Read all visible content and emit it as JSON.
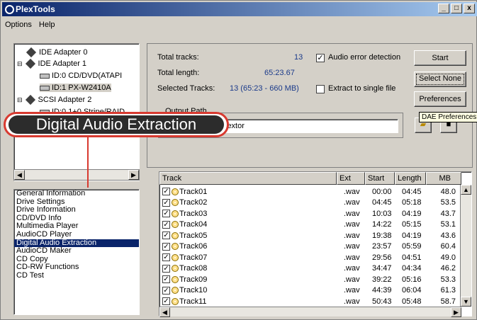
{
  "window": {
    "title": "PlexTools",
    "controls": [
      "_",
      "□",
      "x"
    ]
  },
  "menu": [
    "Options",
    "Help"
  ],
  "tree": [
    {
      "label": "IDE Adapter 0",
      "type": "adapter"
    },
    {
      "label": "IDE Adapter 1",
      "type": "adapter"
    },
    {
      "label": "ID:0  CD/DVD(ATAPI",
      "type": "drive"
    },
    {
      "label": "ID:1  PX-W2410A",
      "type": "drive",
      "selected": true
    },
    {
      "label": "SCSI Adapter 2",
      "type": "adapter"
    },
    {
      "label": "ID:0  1+0 Stripe/RAID",
      "type": "drive"
    }
  ],
  "nav_list": [
    "General Information",
    "Drive Settings",
    "Drive Information",
    "CD/DVD Info",
    "Multimedia Player",
    "AudioCD Player",
    "Digital Audio Extraction",
    "AudioCD Maker",
    "CD Copy",
    "CD-RW Functions",
    "CD Test"
  ],
  "active_nav": "Digital Audio Extraction",
  "summary": {
    "total_tracks_label": "Total tracks:",
    "total_tracks": "13",
    "total_length_label": "Total length:",
    "total_length": "65:23.67",
    "selected_label": "Selected Tracks:",
    "selected": "13  (65:23 - 660 MB)"
  },
  "options": {
    "audio_error_detection": {
      "label": "Audio error detection",
      "checked": true
    },
    "extract_single_file": {
      "label": "Extract to single file",
      "checked": false
    }
  },
  "buttons": {
    "start": "Start",
    "select_none": "Select None",
    "preferences": "Preferences"
  },
  "output_path": {
    "label": "Output Path",
    "value": "lextor"
  },
  "tooltip": "DAE Preferences",
  "callout": "Digital Audio Extraction",
  "track_columns": [
    "Track",
    "Ext",
    "Start",
    "Length",
    "MB"
  ],
  "tracks": [
    {
      "name": "Track01",
      "ext": ".wav",
      "start": "00:00",
      "length": "04:45",
      "mb": "48.0"
    },
    {
      "name": "Track02",
      "ext": ".wav",
      "start": "04:45",
      "length": "05:18",
      "mb": "53.5"
    },
    {
      "name": "Track03",
      "ext": ".wav",
      "start": "10:03",
      "length": "04:19",
      "mb": "43.7"
    },
    {
      "name": "Track04",
      "ext": ".wav",
      "start": "14:22",
      "length": "05:15",
      "mb": "53.1"
    },
    {
      "name": "Track05",
      "ext": ".wav",
      "start": "19:38",
      "length": "04:19",
      "mb": "43.6"
    },
    {
      "name": "Track06",
      "ext": ".wav",
      "start": "23:57",
      "length": "05:59",
      "mb": "60.4"
    },
    {
      "name": "Track07",
      "ext": ".wav",
      "start": "29:56",
      "length": "04:51",
      "mb": "49.0"
    },
    {
      "name": "Track08",
      "ext": ".wav",
      "start": "34:47",
      "length": "04:34",
      "mb": "46.2"
    },
    {
      "name": "Track09",
      "ext": ".wav",
      "start": "39:22",
      "length": "05:16",
      "mb": "53.3"
    },
    {
      "name": "Track10",
      "ext": ".wav",
      "start": "44:39",
      "length": "06:04",
      "mb": "61.3"
    },
    {
      "name": "Track11",
      "ext": ".wav",
      "start": "50:43",
      "length": "05:48",
      "mb": "58.7"
    }
  ],
  "colors": {
    "title_start": "#0a246a",
    "callout_red": "#d83a30",
    "value_blue": "#1a3a8a"
  }
}
